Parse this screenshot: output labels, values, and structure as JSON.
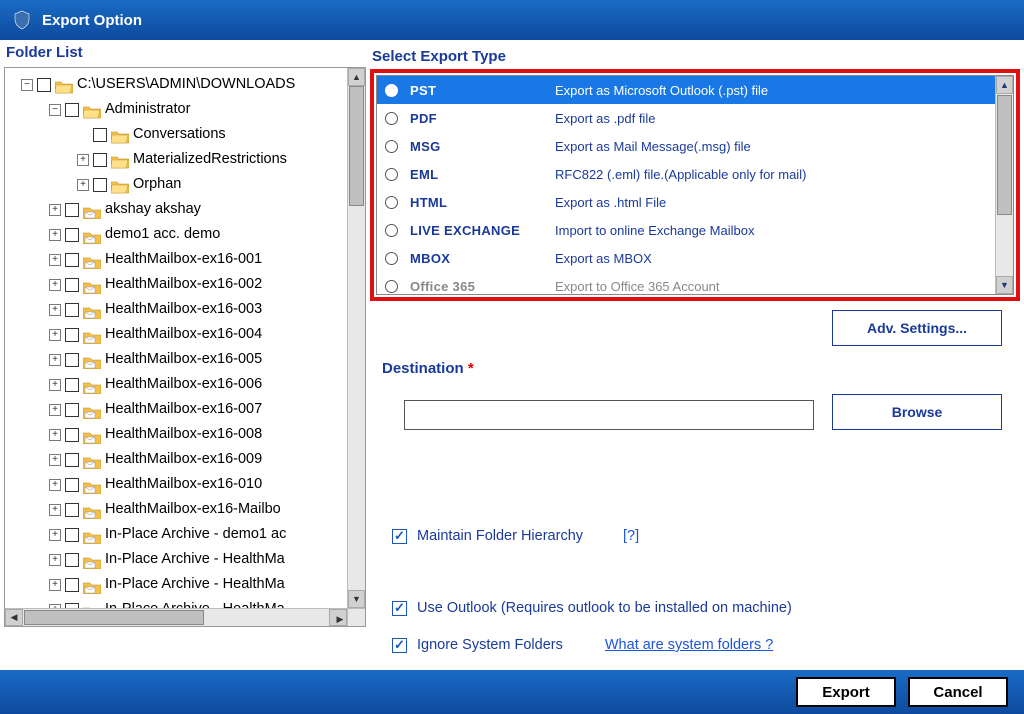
{
  "window": {
    "title": "Export Option"
  },
  "leftPanel": {
    "label": "Folder List",
    "tree": [
      {
        "level": 0,
        "exp": "-",
        "icon": "open",
        "label": "C:\\USERS\\ADMIN\\DOWNLOADS"
      },
      {
        "level": 1,
        "exp": "-",
        "icon": "open",
        "label": "Administrator"
      },
      {
        "level": 2,
        "exp": "",
        "icon": "open",
        "label": "Conversations"
      },
      {
        "level": 2,
        "exp": "+",
        "icon": "open",
        "label": "MaterializedRestrictions"
      },
      {
        "level": 2,
        "exp": "+",
        "icon": "open",
        "label": "Orphan"
      },
      {
        "level": 1,
        "exp": "+",
        "icon": "mail",
        "label": "akshay akshay"
      },
      {
        "level": 1,
        "exp": "+",
        "icon": "mail",
        "label": "demo1 acc. demo"
      },
      {
        "level": 1,
        "exp": "+",
        "icon": "mail",
        "label": "HealthMailbox-ex16-001"
      },
      {
        "level": 1,
        "exp": "+",
        "icon": "mail",
        "label": "HealthMailbox-ex16-002"
      },
      {
        "level": 1,
        "exp": "+",
        "icon": "mail",
        "label": "HealthMailbox-ex16-003"
      },
      {
        "level": 1,
        "exp": "+",
        "icon": "mail",
        "label": "HealthMailbox-ex16-004"
      },
      {
        "level": 1,
        "exp": "+",
        "icon": "mail",
        "label": "HealthMailbox-ex16-005"
      },
      {
        "level": 1,
        "exp": "+",
        "icon": "mail",
        "label": "HealthMailbox-ex16-006"
      },
      {
        "level": 1,
        "exp": "+",
        "icon": "mail",
        "label": "HealthMailbox-ex16-007"
      },
      {
        "level": 1,
        "exp": "+",
        "icon": "mail",
        "label": "HealthMailbox-ex16-008"
      },
      {
        "level": 1,
        "exp": "+",
        "icon": "mail",
        "label": "HealthMailbox-ex16-009"
      },
      {
        "level": 1,
        "exp": "+",
        "icon": "mail",
        "label": "HealthMailbox-ex16-010"
      },
      {
        "level": 1,
        "exp": "+",
        "icon": "mail",
        "label": "HealthMailbox-ex16-Mailbo"
      },
      {
        "level": 1,
        "exp": "+",
        "icon": "mail",
        "label": "In-Place Archive - demo1 ac"
      },
      {
        "level": 1,
        "exp": "+",
        "icon": "mail",
        "label": "In-Place Archive - HealthMa"
      },
      {
        "level": 1,
        "exp": "+",
        "icon": "mail",
        "label": "In-Place Archive - HealthMa"
      },
      {
        "level": 1,
        "exp": "+",
        "icon": "mail",
        "label": "In-Place Archive - HealthMa"
      }
    ]
  },
  "rightPanel": {
    "label": "Select Export Type",
    "types": [
      {
        "name": "PST",
        "desc": "Export as Microsoft Outlook (.pst) file",
        "selected": true
      },
      {
        "name": "PDF",
        "desc": "Export as .pdf file"
      },
      {
        "name": "MSG",
        "desc": "Export as Mail Message(.msg) file"
      },
      {
        "name": "EML",
        "desc": "RFC822 (.eml) file.(Applicable only for mail)"
      },
      {
        "name": "HTML",
        "desc": "Export as .html File"
      },
      {
        "name": "LIVE EXCHANGE",
        "desc": "Import to online Exchange Mailbox"
      },
      {
        "name": "MBOX",
        "desc": "Export as MBOX"
      },
      {
        "name": "Office 365",
        "desc": "Export to Office 365 Account",
        "cut": true
      }
    ],
    "advBtn": "Adv. Settings...",
    "destLabel": "Destination",
    "destReq": "*",
    "destValue": "",
    "browseBtn": "Browse",
    "opt1": "Maintain Folder Hierarchy",
    "opt1Help": "[?]",
    "opt2": "Use Outlook (Requires outlook to be installed on machine)",
    "opt3": "Ignore System Folders",
    "opt3Link": "What are system folders ?"
  },
  "footer": {
    "export": "Export",
    "cancel": "Cancel"
  }
}
